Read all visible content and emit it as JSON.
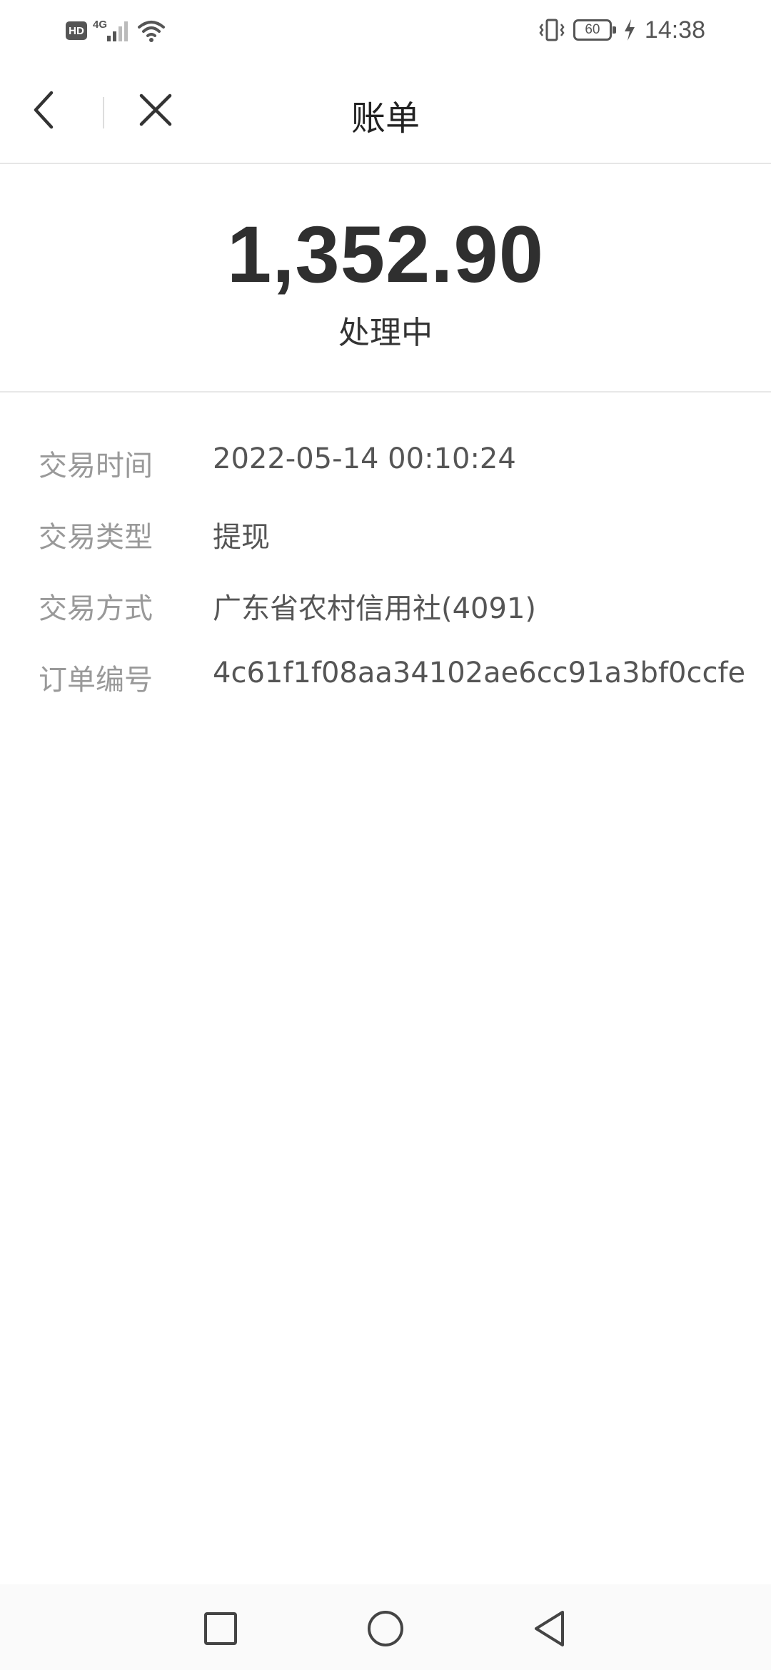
{
  "status_bar": {
    "hd_badge": "HD",
    "network": "4G",
    "battery": "60",
    "time": "14:38"
  },
  "nav": {
    "title": "账单",
    "back_icon": "chevron-left-icon",
    "close_icon": "close-icon"
  },
  "bill": {
    "amount": "1,352.90",
    "status": "处理中"
  },
  "details": [
    {
      "label": "交易时间",
      "value": "2022-05-14 00:10:24"
    },
    {
      "label": "交易类型",
      "value": "提现"
    },
    {
      "label": "交易方式",
      "value": "广东省农村信用社(4091)"
    },
    {
      "label": "订单编号",
      "value": "4c61f1f08aa34102ae6cc91a3bf0ccfe"
    }
  ],
  "system_nav": {
    "recents_icon": "square-icon",
    "home_icon": "circle-icon",
    "back_icon": "triangle-back-icon"
  }
}
